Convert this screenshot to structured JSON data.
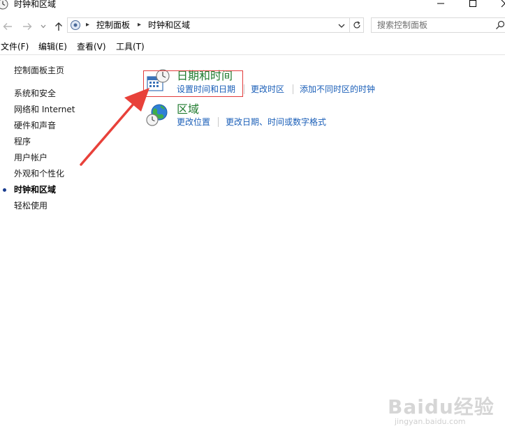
{
  "window": {
    "title": "时钟和区域"
  },
  "address": {
    "crumbs": [
      "控制面板",
      "时钟和区域"
    ]
  },
  "search": {
    "placeholder": "搜索控制面板"
  },
  "menu": [
    "文件(F)",
    "编辑(E)",
    "查看(V)",
    "工具(T)"
  ],
  "sidebar": {
    "home": "控制面板主页",
    "items": [
      "系统和安全",
      "网络和 Internet",
      "硬件和声音",
      "程序",
      "用户帐户",
      "外观和个性化",
      "时钟和区域",
      "轻松使用"
    ],
    "current": "时钟和区域"
  },
  "categories": [
    {
      "title": "日期和时间",
      "icon": "calendar-clock-icon",
      "links": [
        "设置时间和日期",
        "更改时区",
        "添加不同时区的时钟"
      ]
    },
    {
      "title": "区域",
      "icon": "globe-clock-icon",
      "links": [
        "更改位置",
        "更改日期、时间或数字格式"
      ]
    }
  ],
  "watermark": {
    "logo": "Baidu经验",
    "url": "jingyan.baidu.com"
  },
  "colors": {
    "category_title": "#1e7a2d",
    "link": "#1b5fb8",
    "highlight": "#e23b3b",
    "arrow": "#e8413a"
  }
}
